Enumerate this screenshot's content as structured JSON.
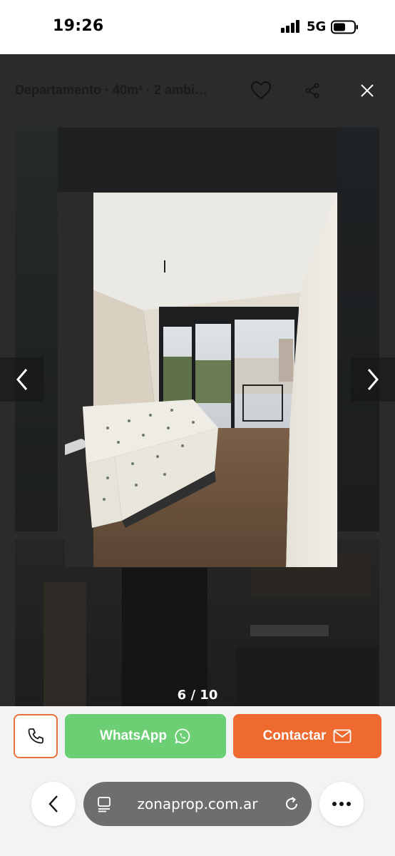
{
  "status_bar": {
    "time": "19:26",
    "network": "5G"
  },
  "gallery": {
    "title": "Departamento · 40m² · 2 ambi…",
    "counter": "6 / 10",
    "icons": {
      "favorite": "heart-icon",
      "share": "share-icon",
      "close": "close-icon",
      "prev": "chevron-left-icon",
      "next": "chevron-right-icon"
    },
    "photo_description_icon": "bedroom-photo"
  },
  "actions": {
    "whatsapp_label": "WhatsApp",
    "contact_label": "Contactar",
    "colors": {
      "whatsapp": "#6ccf74",
      "contact": "#ee6a2e",
      "call_border": "#e8703a"
    }
  },
  "browser": {
    "url": "zonaprop.com.ar"
  }
}
